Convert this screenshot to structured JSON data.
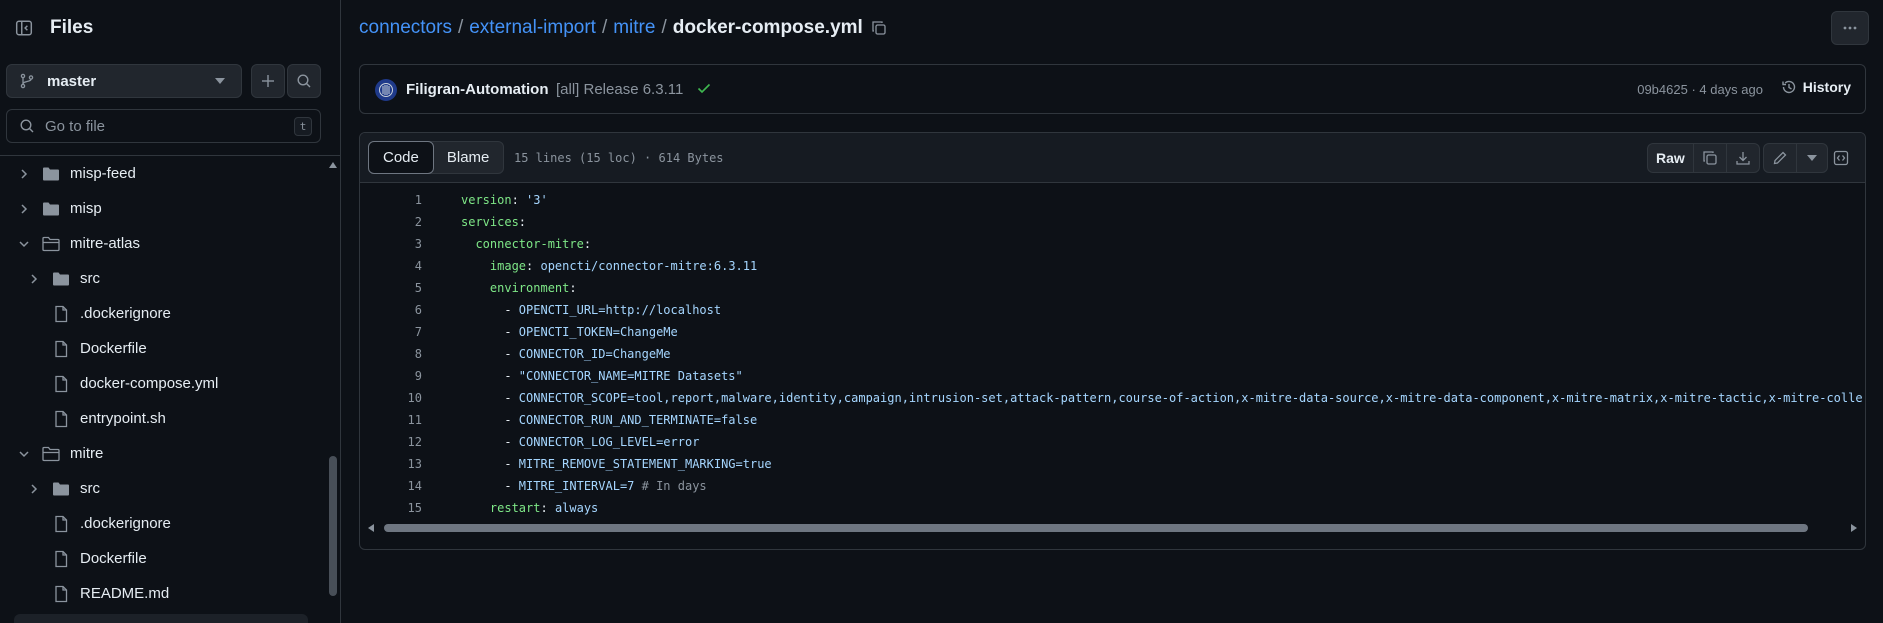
{
  "sidebar": {
    "title": "Files",
    "branch": "master",
    "goto_placeholder": "Go to file",
    "goto_shortcut": "t",
    "tree": [
      {
        "label": "misp-feed",
        "type": "folder",
        "expanded": false,
        "depth": 0
      },
      {
        "label": "misp",
        "type": "folder",
        "expanded": false,
        "depth": 0
      },
      {
        "label": "mitre-atlas",
        "type": "folder",
        "expanded": true,
        "depth": 0
      },
      {
        "label": "src",
        "type": "folder",
        "expanded": false,
        "depth": 1
      },
      {
        "label": ".dockerignore",
        "type": "file",
        "depth": 1
      },
      {
        "label": "Dockerfile",
        "type": "file",
        "depth": 1
      },
      {
        "label": "docker-compose.yml",
        "type": "file",
        "depth": 1
      },
      {
        "label": "entrypoint.sh",
        "type": "file",
        "depth": 1
      },
      {
        "label": "mitre",
        "type": "folder",
        "expanded": true,
        "depth": 0
      },
      {
        "label": "src",
        "type": "folder",
        "expanded": false,
        "depth": 1
      },
      {
        "label": ".dockerignore",
        "type": "file",
        "depth": 1
      },
      {
        "label": "Dockerfile",
        "type": "file",
        "depth": 1
      },
      {
        "label": "README.md",
        "type": "file",
        "depth": 1
      }
    ]
  },
  "breadcrumb": {
    "parts": [
      "connectors",
      "external-import",
      "mitre"
    ],
    "separator": "/",
    "current": "docker-compose.yml"
  },
  "commit": {
    "author": "Filigran-Automation",
    "message": "[all] Release 6.3.11",
    "meta": "09b4625 · 4 days ago",
    "history_label": "History"
  },
  "file": {
    "tabs": [
      "Code",
      "Blame"
    ],
    "active_tab": "Code",
    "info": "15 lines (15 loc) · 614 Bytes",
    "raw_label": "Raw",
    "lines": [
      {
        "n": "1",
        "tokens": [
          {
            "t": "version",
            "c": "k"
          },
          {
            "t": ": "
          },
          {
            "t": "'3'",
            "c": "s"
          }
        ]
      },
      {
        "n": "2",
        "tokens": [
          {
            "t": "services",
            "c": "k"
          },
          {
            "t": ":"
          }
        ]
      },
      {
        "n": "3",
        "tokens": [
          {
            "t": "  "
          },
          {
            "t": "connector-mitre",
            "c": "k"
          },
          {
            "t": ":"
          }
        ]
      },
      {
        "n": "4",
        "tokens": [
          {
            "t": "    "
          },
          {
            "t": "image",
            "c": "k"
          },
          {
            "t": ": "
          },
          {
            "t": "opencti/connector-mitre:6.3.11",
            "c": "s"
          }
        ]
      },
      {
        "n": "5",
        "tokens": [
          {
            "t": "    "
          },
          {
            "t": "environment",
            "c": "k"
          },
          {
            "t": ":"
          }
        ]
      },
      {
        "n": "6",
        "tokens": [
          {
            "t": "      - "
          },
          {
            "t": "OPENCTI_URL=http://localhost",
            "c": "s"
          }
        ]
      },
      {
        "n": "7",
        "tokens": [
          {
            "t": "      - "
          },
          {
            "t": "OPENCTI_TOKEN=ChangeMe",
            "c": "s"
          }
        ]
      },
      {
        "n": "8",
        "tokens": [
          {
            "t": "      - "
          },
          {
            "t": "CONNECTOR_ID=ChangeMe",
            "c": "s"
          }
        ]
      },
      {
        "n": "9",
        "tokens": [
          {
            "t": "      - "
          },
          {
            "t": "\"CONNECTOR_NAME=MITRE Datasets\"",
            "c": "s"
          }
        ]
      },
      {
        "n": "10",
        "tokens": [
          {
            "t": "      - "
          },
          {
            "t": "CONNECTOR_SCOPE=tool,report,malware,identity,campaign,intrusion-set,attack-pattern,course-of-action,x-mitre-data-source,x-mitre-data-component,x-mitre-matrix,x-mitre-tactic,x-mitre-colle",
            "c": "s"
          }
        ]
      },
      {
        "n": "11",
        "tokens": [
          {
            "t": "      - "
          },
          {
            "t": "CONNECTOR_RUN_AND_TERMINATE=false",
            "c": "s"
          }
        ]
      },
      {
        "n": "12",
        "tokens": [
          {
            "t": "      - "
          },
          {
            "t": "CONNECTOR_LOG_LEVEL=error",
            "c": "s"
          }
        ]
      },
      {
        "n": "13",
        "tokens": [
          {
            "t": "      - "
          },
          {
            "t": "MITRE_REMOVE_STATEMENT_MARKING=true",
            "c": "s"
          }
        ]
      },
      {
        "n": "14",
        "tokens": [
          {
            "t": "      - "
          },
          {
            "t": "MITRE_INTERVAL=7",
            "c": "s"
          },
          {
            "t": " # In days",
            "c": "c"
          }
        ]
      },
      {
        "n": "15",
        "tokens": [
          {
            "t": "    "
          },
          {
            "t": "restart",
            "c": "k"
          },
          {
            "t": ": "
          },
          {
            "t": "always",
            "c": "s"
          }
        ]
      }
    ]
  },
  "colors": {
    "accent_link": "#4493f8",
    "yaml_key": "#7ee787",
    "yaml_string": "#a5d6ff",
    "success_check": "#3fb950"
  }
}
